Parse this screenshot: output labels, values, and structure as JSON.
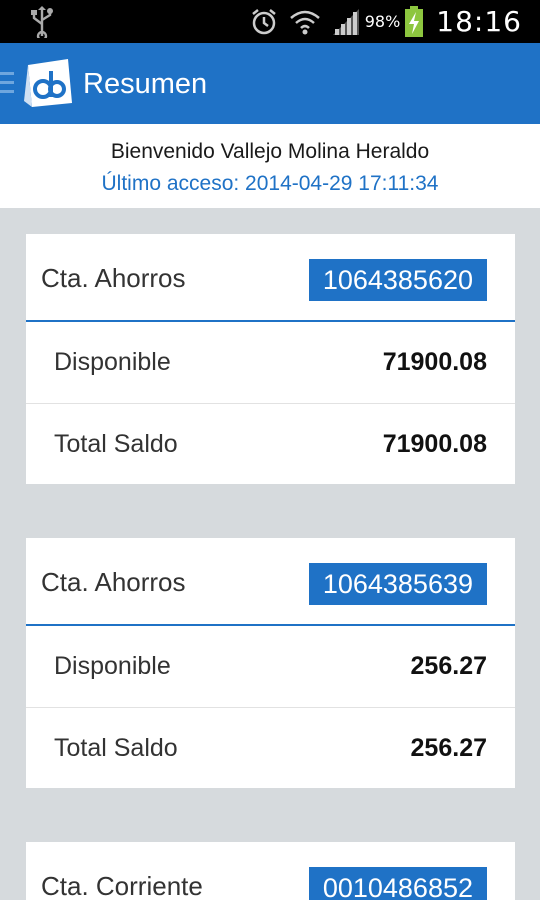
{
  "status_bar": {
    "battery_percent": "98%",
    "time": "18:16",
    "icons": [
      "usb-icon",
      "alarm-icon",
      "wifi-icon",
      "signal-icon",
      "battery-charging-icon"
    ]
  },
  "action_bar": {
    "title": "Resumen",
    "accent_color": "#1f72c6"
  },
  "welcome": {
    "greeting": "Bienvenido Vallejo Molina Heraldo",
    "last_access": "Último acceso: 2014-04-29 17:11:34"
  },
  "accounts": [
    {
      "type": "Cta. Ahorros",
      "number": "1064385620",
      "rows": [
        {
          "label": "Disponible",
          "value": "71900.08"
        },
        {
          "label": "Total Saldo",
          "value": "71900.08"
        }
      ]
    },
    {
      "type": "Cta. Ahorros",
      "number": "1064385639",
      "rows": [
        {
          "label": "Disponible",
          "value": "256.27"
        },
        {
          "label": "Total Saldo",
          "value": "256.27"
        }
      ]
    },
    {
      "type": "Cta. Corriente",
      "number": "0010486852",
      "rows": []
    }
  ]
}
